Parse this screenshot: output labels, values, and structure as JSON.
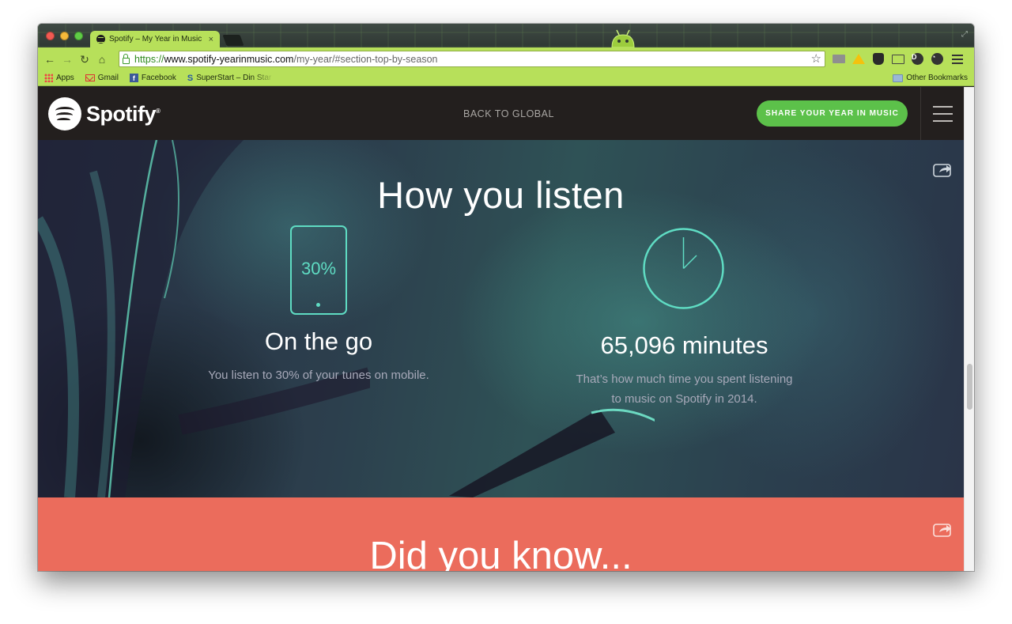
{
  "browser": {
    "tab_title": "Spotify – My Year in Music",
    "tab_close": "×",
    "url_scheme": "https://",
    "url_host": "www.spotify-yearinmusic.com",
    "url_path": "/my-year/#section-top-by-season",
    "nav": {
      "back": "←",
      "forward": "→",
      "reload": "↻",
      "home": "⌂",
      "star": "☆"
    },
    "bookmarks": [
      {
        "label": "Apps",
        "icon": "apps-grid-icon"
      },
      {
        "label": "Gmail",
        "icon": "gmail-icon"
      },
      {
        "label": "Facebook",
        "icon": "facebook-icon"
      },
      {
        "label": "SuperStart – Din Star",
        "icon": "superstart-icon"
      }
    ],
    "other_bookmarks": "Other Bookmarks",
    "extensions": [
      "mail-icon",
      "drive-icon",
      "owl-icon",
      "cast-icon",
      "pocket-icon",
      "clock-extension-icon",
      "chrome-menu-icon"
    ],
    "theme_color": "#b7e05a"
  },
  "site": {
    "logo_text": "Spotify",
    "logo_reg": "®",
    "back_label": "BACK TO GLOBAL",
    "share_label": "SHARE YOUR YEAR IN MUSIC",
    "brand_green": "#5cc14a",
    "header_bg": "#231f1e"
  },
  "listen": {
    "title": "How you listen",
    "mobile_percent": "30%",
    "mobile_title": "On the go",
    "mobile_desc": "You listen to 30% of your tunes on mobile.",
    "minutes_title": "65,096 minutes",
    "minutes_desc_line1": "That’s how much time you spent listening",
    "minutes_desc_line2": "to music on Spotify in 2014.",
    "accent": "#5fdcc3"
  },
  "know": {
    "title": "Did you know...",
    "bg": "#eb6c5c"
  }
}
